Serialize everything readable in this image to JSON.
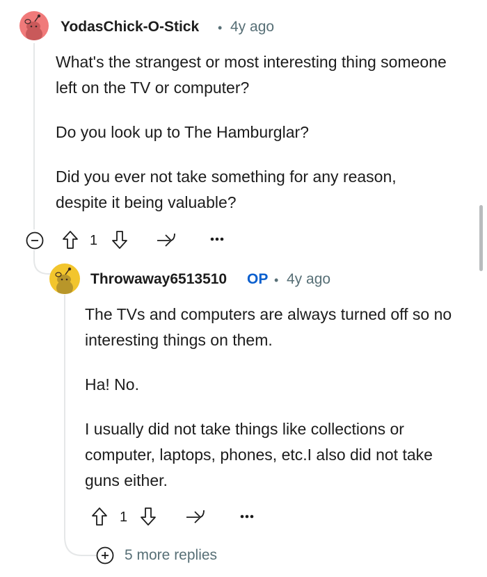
{
  "comment": {
    "author": "YodasChick-O-Stick",
    "separator": "•",
    "timestamp": "4y ago",
    "paragraphs": [
      "What's the strangest or most interesting thing someone left on the TV or computer?",
      "Do you look up to The Hamburglar?",
      "Did you ever not take something for any reason, despite it being valuable?"
    ],
    "votes": "1",
    "avatar_color": "#f07a7a",
    "icons": {
      "collapse": "minus-circle-icon",
      "upvote": "arrow-up-icon",
      "downvote": "arrow-down-icon",
      "share": "share-icon",
      "more": "more-dots-icon"
    }
  },
  "reply": {
    "author": "Throwaway6513510",
    "op_badge": "OP",
    "separator": "•",
    "timestamp": "4y ago",
    "paragraphs": [
      "The TVs and computers are always turned off so no interesting things on them.",
      "Ha! No.",
      "I usually did not take things like collections or computer, laptops, phones, etc.I also did not take guns either."
    ],
    "votes": "1",
    "avatar_color": "#f2c52d",
    "more_replies_label": "5 more replies",
    "icons": {
      "upvote": "arrow-up-icon",
      "downvote": "arrow-down-icon",
      "share": "share-icon",
      "more": "more-dots-icon",
      "expand": "plus-circle-icon"
    }
  },
  "colors": {
    "op_blue": "#0a5fce",
    "meta_gray": "#576f76",
    "thread_line": "#e5e7e8"
  }
}
